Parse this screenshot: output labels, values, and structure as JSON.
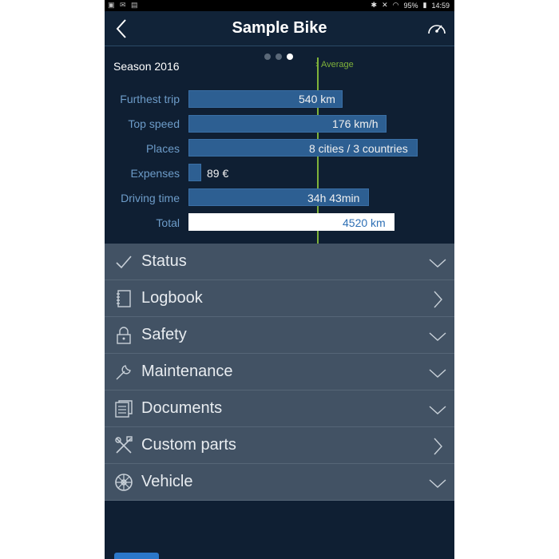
{
  "statusbar": {
    "left_icons": "▣ ✉ ▤",
    "battery": "95%",
    "time": "14:59"
  },
  "header": {
    "title": "Sample Bike"
  },
  "stats": {
    "season": "Season 2016",
    "average_label": "Average",
    "pager": {
      "count": 3,
      "active": 3
    },
    "rows": [
      {
        "label": "Furthest trip",
        "value": "540 km"
      },
      {
        "label": "Top speed",
        "value": "176 km/h"
      },
      {
        "label": "Places",
        "value": "8 cities / 3 countries"
      },
      {
        "label": "Expenses",
        "value": "89 €"
      },
      {
        "label": "Driving time",
        "value": "34h 43min"
      },
      {
        "label": "Total",
        "value": "4520 km"
      }
    ]
  },
  "menu": [
    {
      "label": "Status",
      "icon": "check-icon",
      "chevron": "down"
    },
    {
      "label": "Logbook",
      "icon": "notebook-icon",
      "chevron": "right"
    },
    {
      "label": "Safety",
      "icon": "lock-icon",
      "chevron": "down"
    },
    {
      "label": "Maintenance",
      "icon": "wrench-icon",
      "chevron": "down"
    },
    {
      "label": "Documents",
      "icon": "documents-icon",
      "chevron": "down"
    },
    {
      "label": "Custom parts",
      "icon": "tools-icon",
      "chevron": "right"
    },
    {
      "label": "Vehicle",
      "icon": "wheel-icon",
      "chevron": "down"
    }
  ],
  "colors": {
    "accent": "#2d5f92",
    "average": "#7fb23a",
    "menu_bg": "#425264",
    "panel_bg": "#0f1f33"
  }
}
